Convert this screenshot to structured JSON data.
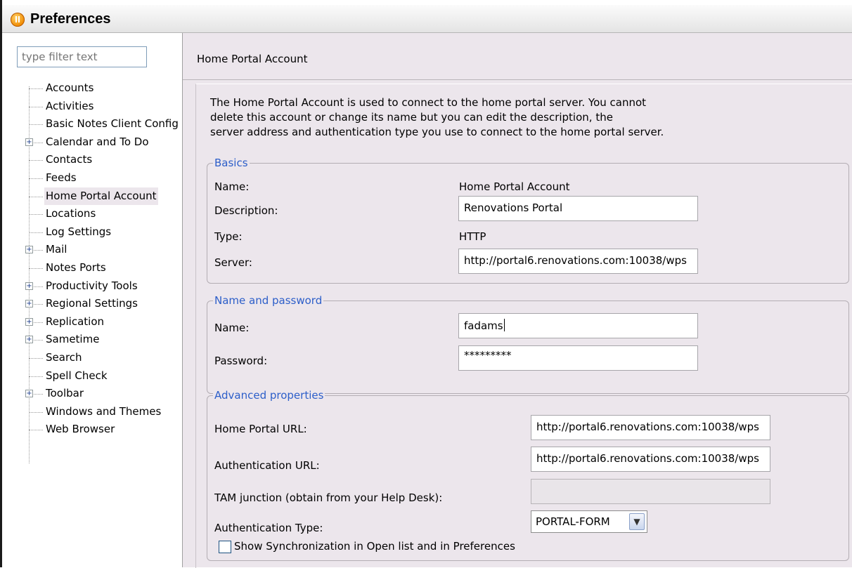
{
  "window": {
    "title": "Preferences"
  },
  "filter": {
    "placeholder": "type filter text"
  },
  "tree": {
    "items": [
      {
        "label": "Accounts",
        "expandable": false,
        "selected": false
      },
      {
        "label": "Activities",
        "expandable": false,
        "selected": false
      },
      {
        "label": "Basic Notes Client Config",
        "expandable": false,
        "selected": false
      },
      {
        "label": "Calendar and To Do",
        "expandable": true,
        "selected": false
      },
      {
        "label": "Contacts",
        "expandable": false,
        "selected": false
      },
      {
        "label": "Feeds",
        "expandable": false,
        "selected": false
      },
      {
        "label": "Home Portal Account",
        "expandable": false,
        "selected": true
      },
      {
        "label": "Locations",
        "expandable": false,
        "selected": false
      },
      {
        "label": "Log Settings",
        "expandable": false,
        "selected": false
      },
      {
        "label": "Mail",
        "expandable": true,
        "selected": false
      },
      {
        "label": "Notes Ports",
        "expandable": false,
        "selected": false
      },
      {
        "label": "Productivity Tools",
        "expandable": true,
        "selected": false
      },
      {
        "label": "Regional Settings",
        "expandable": true,
        "selected": false
      },
      {
        "label": "Replication",
        "expandable": true,
        "selected": false
      },
      {
        "label": "Sametime",
        "expandable": true,
        "selected": false
      },
      {
        "label": "Search",
        "expandable": false,
        "selected": false
      },
      {
        "label": "Spell Check",
        "expandable": false,
        "selected": false
      },
      {
        "label": "Toolbar",
        "expandable": true,
        "selected": false
      },
      {
        "label": "Windows and Themes",
        "expandable": false,
        "selected": false
      },
      {
        "label": "Web Browser",
        "expandable": false,
        "selected": false
      }
    ]
  },
  "page": {
    "title": "Home Portal Account",
    "description": [
      "The Home Portal Account is used to connect to the home portal server. You cannot",
      "delete this account or change its name but you can edit the description, the",
      "server address and authentication type you use to connect to the home portal server."
    ]
  },
  "basics": {
    "legend": "Basics",
    "name_label": "Name:",
    "name_value": "Home Portal Account",
    "description_label": "Description:",
    "description_value": "Renovations Portal",
    "type_label": "Type:",
    "type_value": "HTTP",
    "server_label": "Server:",
    "server_value": "http://portal6.renovations.com:10038/wps"
  },
  "credentials": {
    "legend": "Name and password",
    "name_label": "Name:",
    "name_value": "fadams",
    "password_label": "Password:",
    "password_value": "*********"
  },
  "advanced": {
    "legend": "Advanced properties",
    "home_portal_url_label": "Home Portal URL:",
    "home_portal_url_value": "http://portal6.renovations.com:10038/wps",
    "auth_url_label": "Authentication URL:",
    "auth_url_value": "http://portal6.renovations.com:10038/wps",
    "tam_label": "TAM junction (obtain from your Help Desk):",
    "tam_value": "",
    "auth_type_label": "Authentication Type:",
    "auth_type_value": "PORTAL-FORM",
    "sync_label": "Show Synchronization in Open list and in Preferences",
    "sync_checked": false
  },
  "colors": {
    "legend": "#2c5ec9",
    "pane_bg": "#ece6ec",
    "selected_bg": "#ece6ec"
  },
  "icons": {
    "app": "notes-app-icon",
    "expander": "plus-expander-icon",
    "dropdown": "chevron-down-icon"
  }
}
